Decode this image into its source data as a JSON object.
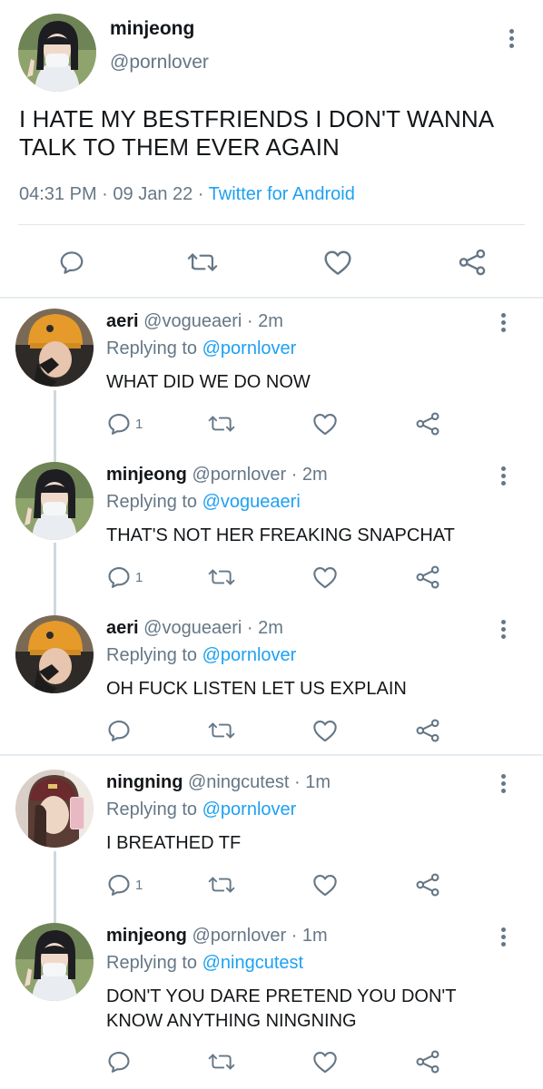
{
  "main_tweet": {
    "name": "minjeong",
    "handle": "@pornlover",
    "text": "I HATE MY BESTFRIENDS I DON'T WANNA TALK TO THEM EVER AGAIN",
    "time": "04:31 PM",
    "date": "09 Jan 22",
    "separator": " · ",
    "source": "Twitter for Android"
  },
  "replies": [
    {
      "name": "aeri",
      "handle": "@vogueaeri",
      "age": "2m",
      "replying_label": "Replying to ",
      "replying_to": "@pornlover",
      "text": "WHAT DID WE DO NOW",
      "reply_count": "1"
    },
    {
      "name": "minjeong",
      "handle": "@pornlover",
      "age": "2m",
      "replying_label": "Replying to ",
      "replying_to": "@vogueaeri",
      "text": "THAT'S NOT HER FREAKING SNAPCHAT",
      "reply_count": "1"
    },
    {
      "name": "aeri",
      "handle": "@vogueaeri",
      "age": "2m",
      "replying_label": "Replying to ",
      "replying_to": "@pornlover",
      "text": "OH FUCK LISTEN LET US EXPLAIN",
      "reply_count": ""
    },
    {
      "name": "ningning",
      "handle": "@ningcutest",
      "age": "1m",
      "replying_label": "Replying to ",
      "replying_to": "@pornlover",
      "text": "I BREATHED TF",
      "reply_count": "1"
    },
    {
      "name": "minjeong",
      "handle": "@pornlover",
      "age": "1m",
      "replying_label": "Replying to ",
      "replying_to": "@ningcutest",
      "text": "DON'T YOU DARE PRETEND YOU DON'T KNOW ANYTHING NINGNING",
      "reply_count": ""
    }
  ],
  "dot_separator": " · ",
  "colors": {
    "text": "#14171a",
    "secondary": "#657786",
    "link": "#1da1f2",
    "divider": "#e6ecf0"
  }
}
